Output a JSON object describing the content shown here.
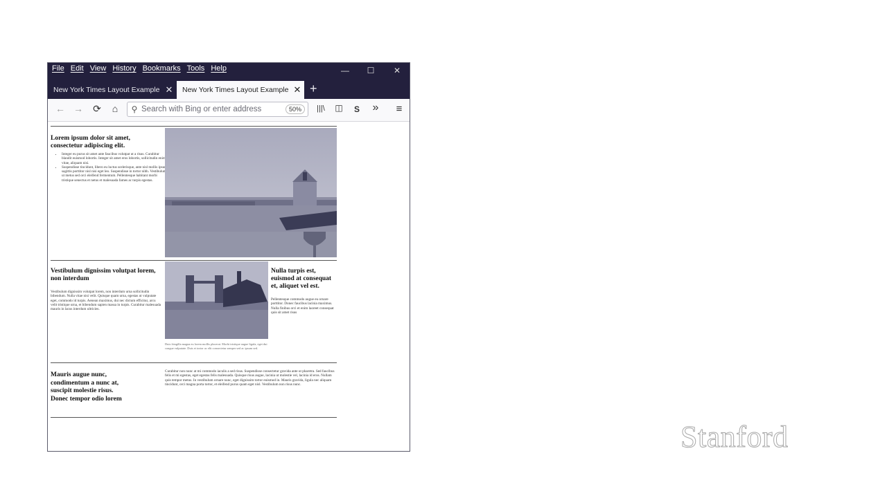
{
  "menu": [
    "File",
    "Edit",
    "View",
    "History",
    "Bookmarks",
    "Tools",
    "Help"
  ],
  "window_controls": {
    "minimize": "—",
    "maximize": "☐",
    "close": "✕"
  },
  "tabs": [
    {
      "label": "New York Times Layout Example",
      "close": "✕"
    },
    {
      "label": "New York Times Layout Example",
      "close": "✕"
    }
  ],
  "new_tab": "+",
  "nav": {
    "back": "←",
    "forward": "→",
    "reload": "⟳",
    "home": "⌂",
    "search_icon": "⚲"
  },
  "address": {
    "placeholder": "Search with Bing or enter address",
    "zoom": "50%"
  },
  "toolbar": {
    "library": "|||\\",
    "sidebar": "◫",
    "s_ext": "S",
    "overflow": "»",
    "menu": "≡"
  },
  "article": {
    "s1": {
      "heading": "Lorem ipsum dolor sit amet, consectetur adipiscing elit.",
      "bullets": [
        "Integer eu purus sit amet ante faucibus volutpat ut a risus. Curabitur blandit euismod lobortis. Integer sit amet eros lobortis, sollicitudin enim vitae, aliquam nisi.",
        "Suspendisse tincidunt, libero eu luctus scelerisque, ante nisl mollis ipsum, sagittis porttitor nisl nisi eget leo. Suspendisse in tortor nibh. Vestibulum ut metus sed orci eleifend fermentum. Pellentesque habitant morbi tristique senectus et netus et malesuada fames ac turpis egestas."
      ]
    },
    "s2": {
      "heading": "Vestibulum dignissim volutpat lorem, non interdum",
      "body": "Vestibulum dignissim volutpat lorem, non interdum urna sollicitudin bibendum. Nulla vitae nisi velit. Quisque quam urna, egestas ut vulputate eget, commodo id turpis. Aenean maximus, dui nec dictum efficitur, arcu velit tristique urna, et bibendum sapien massa in turpis. Curabitur malesuada mauris in lacus interdum ultricies.",
      "caption": "Duis fringilla magna eu lorem mollis placerat. Morbi tristique augue ligula, eget dui congue vulputate. Duis et tortor ac elit consectetur semper sed ac ipsum sed.",
      "side_heading": "Nulla turpis est, euismod at consequat et, aliquet vel est.",
      "side_body": "Pellentesque commodo augue eu ornare porttitor. Donec faucibus lacinia maximus. Nulla finibus orci et enim laoreet consequat quis sit amet risus"
    },
    "s3": {
      "heading": "Mauris augue nunc, condimentum a nunc at, suscipit molestie risus. Donec tempor odio lorem",
      "body": "Curabitur non nunc at mi commodo iaculis a sed risus. Suspendisse consectetur gravida ante ut pharetra. Sed faucibus felis et mi egestas, eget egestas felis malesuada. Quisque risus augue, lacinia ut molestie vel, lacinia id eros. Nullam quis tempor metus. In vestibulum ornare nunc, eget dignissim tortor euismod in. Mauris gravida, ligula nec aliquam tincidunt, orci magna porta tortor, et eleifend purus quam eget nisl. Vestibulum non risus nunc."
    }
  },
  "watermark": "Stanford"
}
